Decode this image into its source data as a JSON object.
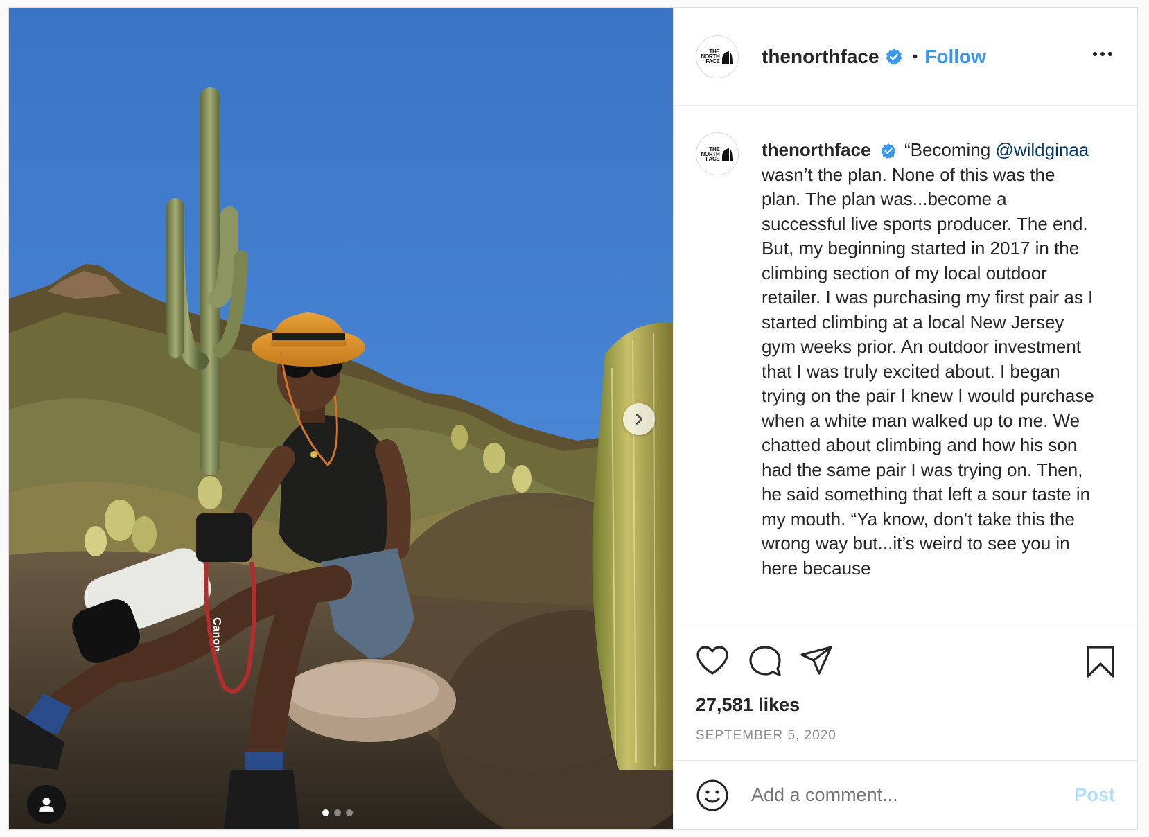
{
  "post": {
    "username": "thenorthface",
    "follow_label": "Follow",
    "separator": "•",
    "avatar_logo_lines": [
      "THE",
      "NORTH",
      "FACE"
    ],
    "caption_username": "thenorthface",
    "caption_opening": "“Becoming",
    "caption_mention": "@wildginaa",
    "caption_text": "wasn’t the plan. None of this was the plan. The plan was...become a successful live sports producer. The end. But, my beginning started in 2017 in the climbing section of my local outdoor retailer. I was purchasing my first pair as I started climbing at a local New Jersey gym weeks prior. An outdoor investment that I was truly excited about. I began trying on the pair I knew I would purchase when a white man walked up to me. We chatted about climbing and how his son had the same pair I was trying on. Then, he said something that left a sour taste in my mouth. “Ya know, don’t take this the wrong way but...it’s weird to see you in here because",
    "likes": "27,581 likes",
    "date": "SEPTEMBER 5, 2020",
    "comment_placeholder": "Add a comment...",
    "post_button": "Post"
  },
  "media": {
    "carousel_total": 3,
    "carousel_active": 1,
    "camera_brand_text": "Canon"
  },
  "icons": {
    "like": "heart-icon",
    "comment": "comment-icon",
    "share": "paper-plane-icon",
    "save": "bookmark-icon",
    "emoji": "smiley-icon",
    "more": "ellipsis-icon",
    "verified": "verified-badge-icon",
    "next": "chevron-right-icon",
    "user_tag": "user-icon"
  },
  "colors": {
    "link": "#3897f0",
    "mention": "#00376b",
    "verified": "#3897f0",
    "post_disabled": "#b2dffc",
    "secondary_text": "#8e8e8e"
  }
}
